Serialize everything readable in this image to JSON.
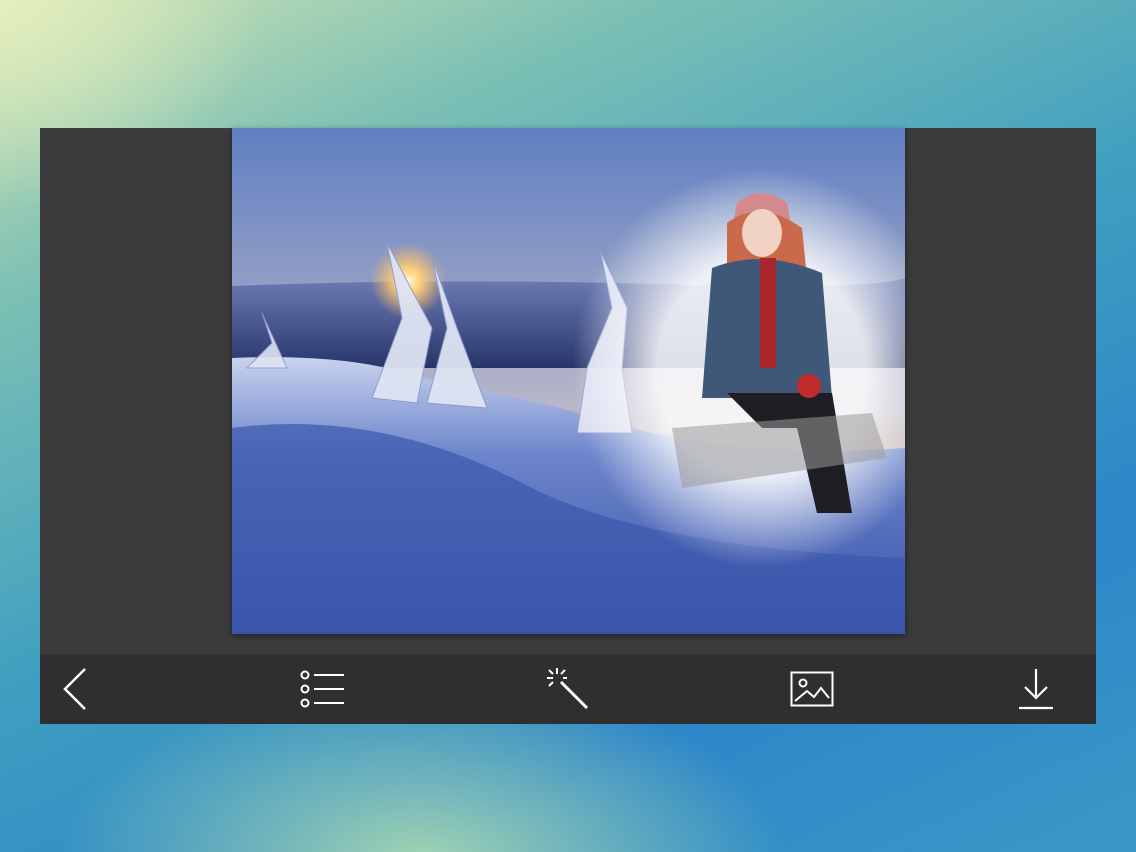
{
  "app": {
    "screen": "photo-frame-editor"
  },
  "photo": {
    "scene": "snowy-mountain-sunset",
    "subject": "woman-in-winter-clothes-on-sled",
    "colors": {
      "sky_top": "#5f7fc2",
      "sky_horizon": "#f3b067",
      "snow": "#4a66b5",
      "frame_bg": "#3b3b3d",
      "toolbar_bg": "#2f2f31"
    }
  },
  "toolbar": {
    "buttons": [
      {
        "id": "back",
        "icon": "chevron-left-icon"
      },
      {
        "id": "frames",
        "icon": "list-icon"
      },
      {
        "id": "effects",
        "icon": "magic-wand-icon"
      },
      {
        "id": "gallery",
        "icon": "image-icon"
      },
      {
        "id": "save",
        "icon": "download-icon"
      }
    ],
    "icon_color": "#ffffff"
  }
}
